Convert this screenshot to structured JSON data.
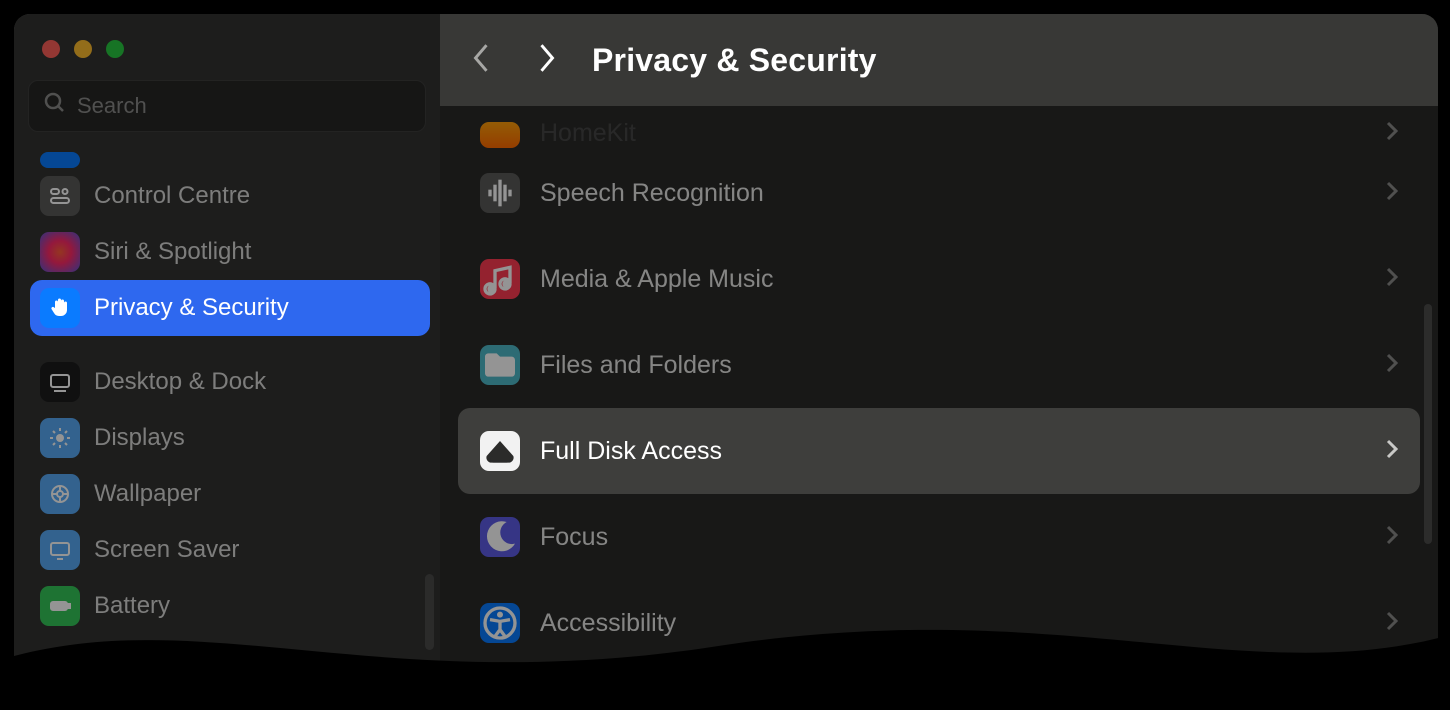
{
  "header": {
    "title": "Privacy & Security"
  },
  "search": {
    "placeholder": "Search"
  },
  "sidebar": {
    "items": [
      {
        "label": "Control Centre",
        "icon": "control-centre"
      },
      {
        "label": "Siri & Spotlight",
        "icon": "siri"
      },
      {
        "label": "Privacy & Security",
        "icon": "hand",
        "selected": true
      },
      {
        "label": "Desktop & Dock",
        "icon": "dock"
      },
      {
        "label": "Displays",
        "icon": "displays"
      },
      {
        "label": "Wallpaper",
        "icon": "wallpaper"
      },
      {
        "label": "Screen Saver",
        "icon": "screensaver"
      },
      {
        "label": "Battery",
        "icon": "battery"
      }
    ]
  },
  "list": {
    "items": [
      {
        "label": "HomeKit",
        "icon": "homekit",
        "color": "orange",
        "cut": true
      },
      {
        "label": "Speech Recognition",
        "icon": "speech",
        "color": "grey"
      },
      {
        "label": "Media & Apple Music",
        "icon": "music",
        "color": "red"
      },
      {
        "label": "Files and Folders",
        "icon": "folder",
        "color": "teal"
      },
      {
        "label": "Full Disk Access",
        "icon": "disk",
        "color": "grey",
        "hover": true
      },
      {
        "label": "Focus",
        "icon": "focus",
        "color": "indigo"
      },
      {
        "label": "Accessibility",
        "icon": "accessibility",
        "color": "blue"
      }
    ]
  }
}
